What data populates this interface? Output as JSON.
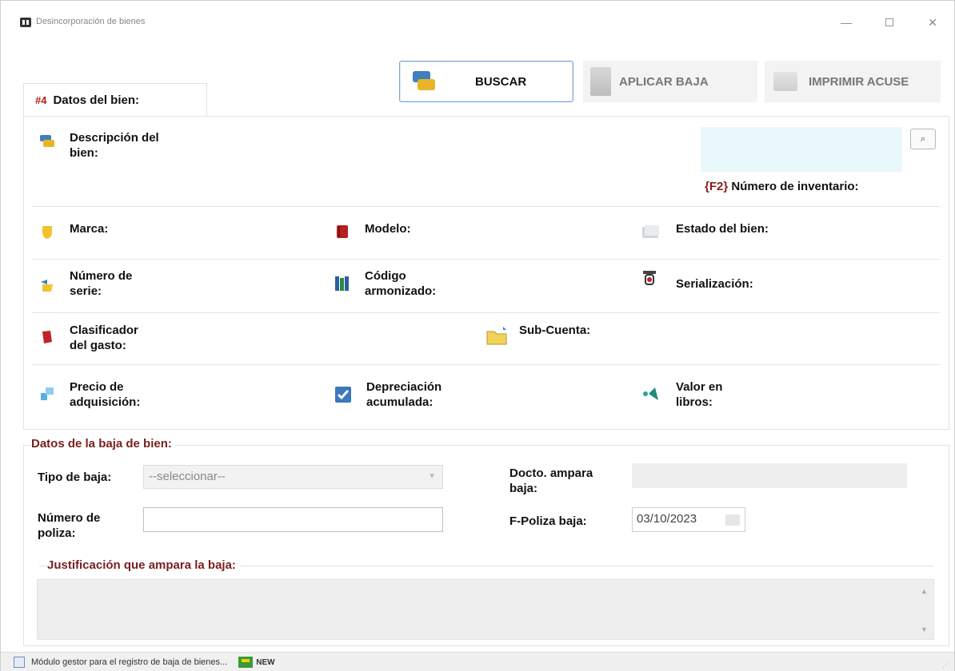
{
  "window": {
    "title": "Desincorporación de bienes",
    "minimize_glyph": "—",
    "close_glyph": "✕"
  },
  "toolbar": {
    "buscar_label": "BUSCAR",
    "aplicar_label": "APLICAR BAJA",
    "imprimir_label": "IMPRIMIR ACUSE"
  },
  "tab": {
    "label": "Datos del bien:",
    "icon_glyph": "#4"
  },
  "bien": {
    "descripcion_label": "Descripción del\nbien:",
    "lookup_button": "⌕",
    "inventario_f2": "{F2}",
    "inventario_label": "Número de inventario:",
    "marca_label": "Marca:",
    "modelo_label": "Modelo:",
    "estado_label": "Estado del bien:",
    "serie_label": "Número de\nserie:",
    "codigo_label": "Código\narmonizado:",
    "serializacion_label": "Serialización:",
    "clasificador_label": "Clasificador\ndel gasto:",
    "subcuenta_label": "Sub-Cuenta:",
    "precio_label": "Precio de\nadquisición:",
    "depreciacion_label": "Depreciación\nacumulada:",
    "valor_label": "Valor en\nlibros:"
  },
  "baja": {
    "section_title": "Datos de la baja de bien:",
    "tipo_label": "Tipo de baja:",
    "tipo_value": "--seleccionar--",
    "docto_label": "Docto. ampara\nbaja:",
    "poliza_label": "Número de\npoliza:",
    "poliza_value": "",
    "fpoliza_label": "F-Poliza baja:",
    "fpoliza_value": "03/10/2023",
    "justificacion_title": "Justificación que ampara la baja:"
  },
  "statusbar": {
    "message": "Módulo gestor para el registro de baja de bienes...",
    "badge": "NEW"
  }
}
